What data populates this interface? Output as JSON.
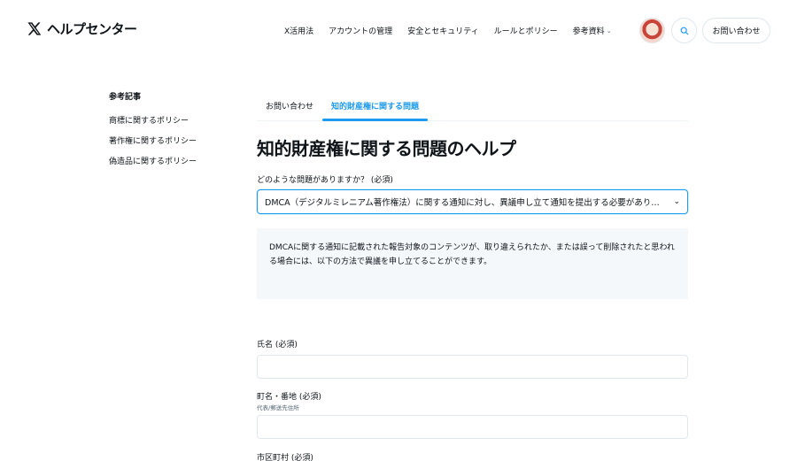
{
  "header": {
    "brand_name": "ヘルプセンター",
    "nav": [
      {
        "label": "X活用法"
      },
      {
        "label": "アカウントの管理"
      },
      {
        "label": "安全とセキュリティ"
      },
      {
        "label": "ルールとポリシー"
      },
      {
        "label": "参考資料"
      }
    ],
    "contact_label": "お問い合わせ"
  },
  "sidebar": {
    "title": "参考記事",
    "items": [
      {
        "label": "商標に関するポリシー"
      },
      {
        "label": "著作権に関するポリシー"
      },
      {
        "label": "偽造品に関するポリシー"
      }
    ]
  },
  "main": {
    "tabs": [
      {
        "label": "お問い合わせ"
      },
      {
        "label": "知的財産権に関する問題"
      }
    ],
    "title": "知的財産権に関する問題のヘルプ",
    "question_label": "どのような問題がありますか？ (必須)",
    "selected_option": "DMCA（デジタルミレニアム著作権法）に関する通知に対し、異議申し立て通知を提出する必要があります",
    "info_text": "DMCAに関する通知に記載された報告対象のコンテンツが、取り違えられたか、または誤って削除されたと思われる場合には、以下の方法で異議を申し立てることができます。"
  },
  "form": {
    "name_label": "氏名 (必須)",
    "address_label": "町名・番地 (必須)",
    "address_sub": "代表/郵送先住所",
    "city_label": "市区町村 (必須)"
  },
  "colors": {
    "accent": "#1d9bf0",
    "text": "#0f1419",
    "info_bg": "#f5f8fa",
    "border": "#e1e8ed"
  },
  "icons": {
    "logo": "x-logo-icon",
    "search": "search-icon",
    "chevron": "chevron-down-icon"
  }
}
